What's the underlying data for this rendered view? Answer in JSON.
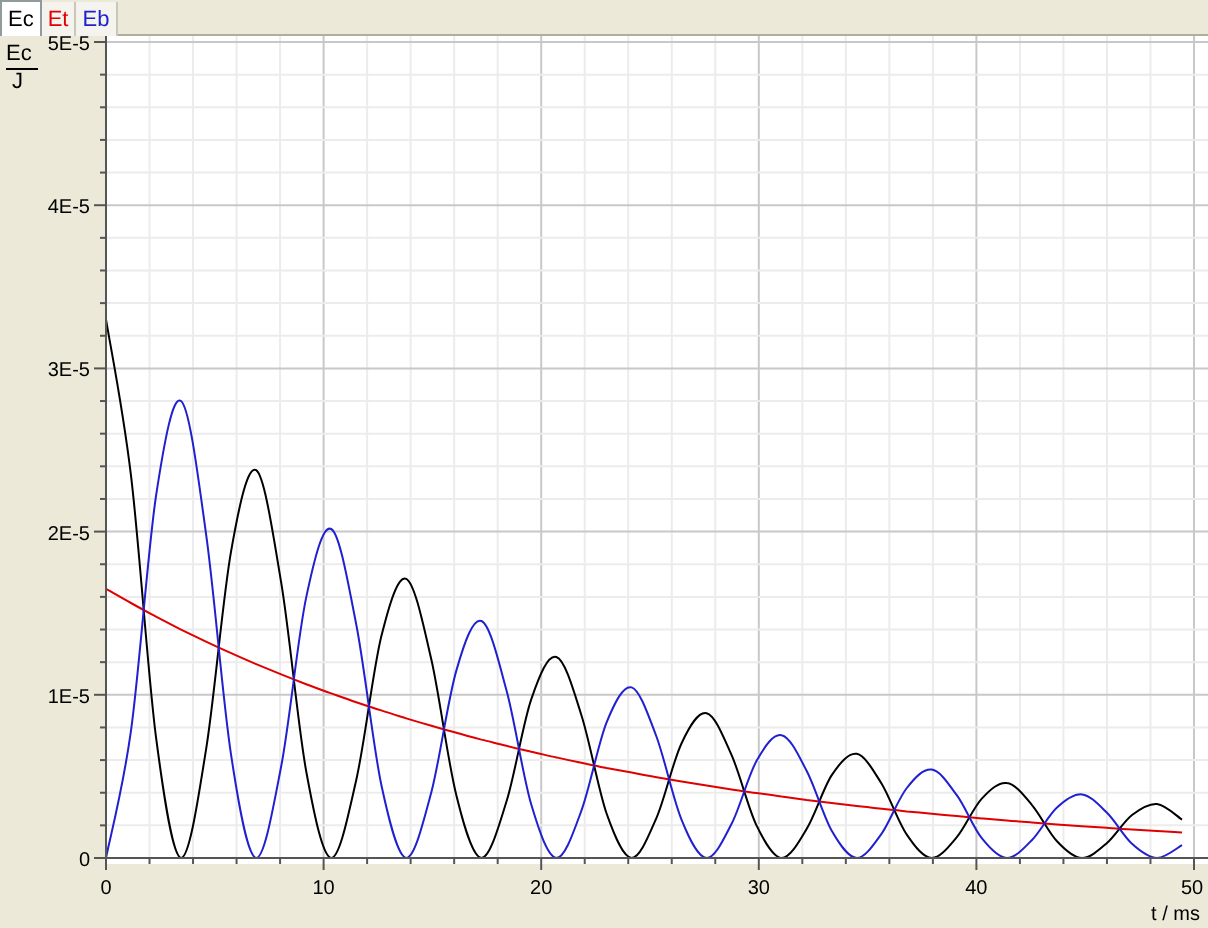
{
  "tabs": [
    {
      "selected": true
    },
    {
      "selected": false
    },
    {
      "selected": false
    }
  ],
  "axis_label": {
    "quantity": "Ec",
    "unit": "J"
  },
  "chart_data": {
    "type": "line",
    "grid": true,
    "xlabel": "t / ms",
    "xlim": [
      0,
      50
    ],
    "ylim": [
      0,
      5e-05
    ],
    "xticks": [
      0,
      10,
      20,
      30,
      40,
      50
    ],
    "yticks": [
      {
        "value": 0,
        "label": "0"
      },
      {
        "value": 1e-05,
        "label": "1E-5"
      },
      {
        "value": 2e-05,
        "label": "2E-5"
      },
      {
        "value": 3e-05,
        "label": "3E-5"
      },
      {
        "value": 4e-05,
        "label": "4E-5"
      },
      {
        "value": 5e-05,
        "label": "5E-5"
      }
    ],
    "x": [
      0,
      1.15,
      2.3,
      3.45,
      4.6,
      5.75,
      6.9,
      8.05,
      9.2,
      10.35,
      11.5,
      12.65,
      13.8,
      14.95,
      16.1,
      17.25,
      18.4,
      19.55,
      20.7,
      21.85,
      23,
      24.15,
      25.3,
      26.45,
      27.6,
      28.75,
      29.9,
      31.05,
      32.2,
      33.35,
      34.5,
      35.65,
      36.8,
      37.95,
      39.1,
      40.25,
      41.4,
      42.55,
      43.7,
      44.85,
      46,
      47.15,
      48.3,
      49.45
    ],
    "series": [
      {
        "name": "Ec",
        "color": "#000000",
        "values": [
          3.3e-05,
          2.343e-05,
          7.4e-06,
          0,
          6.63e-06,
          1.883e-05,
          2.376e-05,
          1.687e-05,
          5.32e-06,
          0,
          4.77e-06,
          1.355e-05,
          1.711e-05,
          1.215e-05,
          3.83e-06,
          0,
          3.44e-06,
          9.76e-06,
          1.232e-05,
          8.75e-06,
          2.76e-06,
          0,
          2.47e-06,
          7.03e-06,
          8.87e-06,
          6.3e-06,
          1.99e-06,
          0,
          1.78e-06,
          5.06e-06,
          6.38e-06,
          4.53e-06,
          1.43e-06,
          0,
          1.28e-06,
          3.64e-06,
          4.6e-06,
          3.26e-06,
          1.03e-06,
          0,
          9.2e-07,
          2.63e-06,
          3.31e-06,
          2.35e-06
        ]
      },
      {
        "name": "Et",
        "color": "#e00000",
        "values": [
          1.65e-05,
          1.562e-05,
          1.479e-05,
          1.4e-05,
          1.326e-05,
          1.255e-05,
          1.188e-05,
          1.125e-05,
          1.065e-05,
          1.008e-05,
          9.55e-06,
          9.04e-06,
          8.56e-06,
          8.1e-06,
          7.67e-06,
          7.26e-06,
          6.87e-06,
          6.51e-06,
          6.16e-06,
          5.83e-06,
          5.52e-06,
          5.23e-06,
          4.95e-06,
          4.69e-06,
          4.44e-06,
          4.2e-06,
          3.98e-06,
          3.77e-06,
          3.56e-06,
          3.37e-06,
          3.19e-06,
          3.02e-06,
          2.86e-06,
          2.71e-06,
          2.57e-06,
          2.43e-06,
          2.3e-06,
          2.18e-06,
          2.06e-06,
          1.95e-06,
          1.85e-06,
          1.75e-06,
          1.66e-06,
          1.57e-06
        ]
      },
      {
        "name": "Eb",
        "color": "#2020d0",
        "values": [
          0,
          7.81e-06,
          2.218e-05,
          2.8e-05,
          1.988e-05,
          6.27e-06,
          0,
          5.62e-06,
          1.597e-05,
          2.016e-05,
          1.432e-05,
          4.52e-06,
          0,
          4.05e-06,
          1.15e-05,
          1.452e-05,
          1.03e-05,
          3.25e-06,
          0,
          2.91e-06,
          8.28e-06,
          1.045e-05,
          7.42e-06,
          2.34e-06,
          0,
          2.1e-06,
          5.96e-06,
          7.53e-06,
          5.34e-06,
          1.68e-06,
          0,
          1.51e-06,
          4.29e-06,
          5.42e-06,
          3.85e-06,
          1.21e-06,
          0,
          1.09e-06,
          3.09e-06,
          3.9e-06,
          2.77e-06,
          8.7e-07,
          0,
          7.8e-07
        ]
      }
    ]
  }
}
